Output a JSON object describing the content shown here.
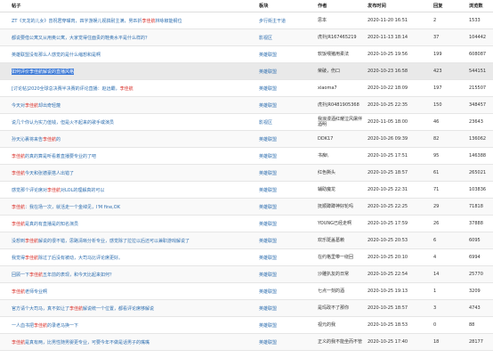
{
  "headers": {
    "title": "帖子",
    "forum": "板块",
    "author": "作者",
    "time": "发布时间",
    "reply": "回复",
    "views": "浏览数"
  },
  "colors": {
    "link": "#2f6fb0",
    "hot": "#d9302a",
    "highlight": "#3a78d6"
  },
  "rows": [
    {
      "title": [
        {
          "t": "ZT《天龙的儿女》曾祝君穿嘴肉，四字游娱儿视搞耐主满，男匹折"
        },
        {
          "t": "李佳航",
          "hot": true
        },
        {
          "t": "林咏椒能纲位"
        }
      ],
      "forum": "步行街主干道",
      "author": "思本",
      "time": "2020-11-20 16:51",
      "reply": "2",
      "views": "1533"
    },
    {
      "title": [
        {
          "t": "都说要借公寓又从用奥公寓，大家觉得住面贵的鞋奥水平是什么样的？"
        }
      ],
      "forum": "影视区",
      "author": "虎扑JR167465219",
      "time": "2020-11-13 18:14",
      "reply": "37",
      "views": "104442"
    },
    {
      "title": [
        {
          "t": "英雄联盟没有那么人感觉的是什么缩想和是啊"
        }
      ],
      "forum": "英雄联盟",
      "author": "软饭喂猪用柔法",
      "time": "2020-10-25 19:56",
      "reply": "199",
      "views": "608087"
    },
    {
      "title": [
        {
          "t": "如何评价李佳航解说的直播风格"
        }
      ],
      "forum": "英雄联盟",
      "author": "荣破，伤口",
      "time": "2020-10-23 16:58",
      "reply": "423",
      "views": "544151",
      "highlight": true
    },
    {
      "title": [
        {
          "t": "[讨论帖]2020全球总决赛半决赛的评论直播：赵远霸，"
        },
        {
          "t": "李佳航",
          "hot": true
        }
      ],
      "forum": "英雄联盟",
      "author": "xiaoma7",
      "time": "2020-10-22 18:09",
      "reply": "197",
      "views": "215507"
    },
    {
      "title": [
        {
          "t": "今天对"
        },
        {
          "t": "李佳航",
          "hot": true
        },
        {
          "t": "却出奇轻蔑"
        }
      ],
      "forum": "英雄联盟",
      "author": "虎扑JR0481905368",
      "time": "2020-10-25 22:35",
      "reply": "150",
      "views": "348457"
    },
    {
      "title": [
        {
          "t": "说几个你认为实力值钱，但是火不起来的歌手或演员"
        }
      ],
      "forum": "影视区",
      "author": "我浪漫酒红耀泣风屠伴酒明",
      "time": "2020-11-05 18:00",
      "reply": "46",
      "views": "23643"
    },
    {
      "title": [
        {
          "t": "孙天沁裹将来告"
        },
        {
          "t": "李佳航",
          "hot": true
        },
        {
          "t": "的"
        }
      ],
      "forum": "英雄联盟",
      "author": "DDK17",
      "time": "2020-10-26 09:39",
      "reply": "82",
      "views": "136062"
    },
    {
      "title": [
        {
          "t": "李佳航",
          "hot": true
        },
        {
          "t": "的真的算是听看着直播要专业的了吧"
        }
      ],
      "forum": "英雄联盟",
      "author": "书痴\\",
      "time": "2020-10-25 17:51",
      "reply": "95",
      "views": "146388"
    },
    {
      "title": [
        {
          "t": "李佳航",
          "hot": true
        },
        {
          "t": "今天和张德豪搭人出错了"
        }
      ],
      "forum": "英雄联盟",
      "author": "红色撕头",
      "time": "2020-10-25 18:57",
      "reply": "61",
      "views": "265021"
    },
    {
      "title": [
        {
          "t": "感觉那个评论席对"
        },
        {
          "t": "李佳航",
          "hot": true
        },
        {
          "t": "对LOL的理解真的可以"
        }
      ],
      "forum": "英雄联盟",
      "author": "辅助魔龙",
      "time": "2020-10-25 22:31",
      "reply": "71",
      "views": "103836"
    },
    {
      "title": [
        {
          "t": "李佳航",
          "hot": true
        },
        {
          "t": "：我在场一次，就活走一个金绰见，I'M fine,OK"
        }
      ],
      "forum": "英雄联盟",
      "author": "抚顺蹲蹲神好轮吗",
      "time": "2020-10-25 22:25",
      "reply": "29",
      "views": "71818"
    },
    {
      "title": [
        {
          "t": "李佳航",
          "hot": true
        },
        {
          "t": "是真的有直播是的知名演员"
        }
      ],
      "forum": "英雄联盟",
      "author": "YOUNG已经走啊",
      "time": "2020-10-25 17:59",
      "reply": "26",
      "views": "37888"
    },
    {
      "title": [
        {
          "t": "没想到"
        },
        {
          "t": "李佳航",
          "hot": true
        },
        {
          "t": "解说的很不错，思路清晰分析专业，感觉除了拉拉以后还可以兼职游戏解说了"
        }
      ],
      "forum": "英雄联盟",
      "author": "欢乐斑盖葛赖",
      "time": "2020-10-25 20:53",
      "reply": "6",
      "views": "6095"
    },
    {
      "title": [
        {
          "t": "我觉得"
        },
        {
          "t": "李佳航",
          "hot": true
        },
        {
          "t": "除过了后没有被动，大司马比评论席更好。"
        }
      ],
      "forum": "英雄联盟",
      "author": "在约格里带一绕回",
      "time": "2020-10-25 20:10",
      "reply": "4",
      "views": "6994"
    },
    {
      "title": [
        {
          "t": "回顾一下"
        },
        {
          "t": "李佳航",
          "hot": true
        },
        {
          "t": "五年前的表现，和今天比起来如何？"
        }
      ],
      "forum": "英雄联盟",
      "author": "沙雕扒友的日常",
      "time": "2020-10-25 22:54",
      "reply": "14",
      "views": "25770"
    },
    {
      "title": [
        {
          "t": "李佳航",
          "hot": true
        },
        {
          "t": "老师专业啊"
        }
      ],
      "forum": "英雄联盟",
      "author": "七点一刻的酒",
      "time": "2020-10-25 19:13",
      "reply": "1",
      "views": "3209"
    },
    {
      "title": [
        {
          "t": "官方请个大司马，真不如让了"
        },
        {
          "t": "李佳航",
          "hot": true
        },
        {
          "t": "解说统一个位置，都看评论席够解说"
        }
      ],
      "forum": "英雄联盟",
      "author": "是玛政不了那你",
      "time": "2020-10-25 18:57",
      "reply": "3",
      "views": "4743"
    },
    {
      "title": [
        {
          "t": "一人血书把"
        },
        {
          "t": "李佳航",
          "hot": true
        },
        {
          "t": "的录老马换一下"
        }
      ],
      "forum": "英雄联盟",
      "author": "视元的我",
      "time": "2020-10-25 18:53",
      "reply": "0",
      "views": "88"
    },
    {
      "title": [
        {
          "t": "李佳航",
          "hot": true
        },
        {
          "t": "是真有两，比男性随男婴更专业，可要今年不做是话男子的嘴嘴"
        }
      ],
      "forum": "英雄联盟",
      "author": "正义的我不能坐而不管",
      "time": "2020-10-25 17:40",
      "reply": "18",
      "views": "28177"
    }
  ]
}
